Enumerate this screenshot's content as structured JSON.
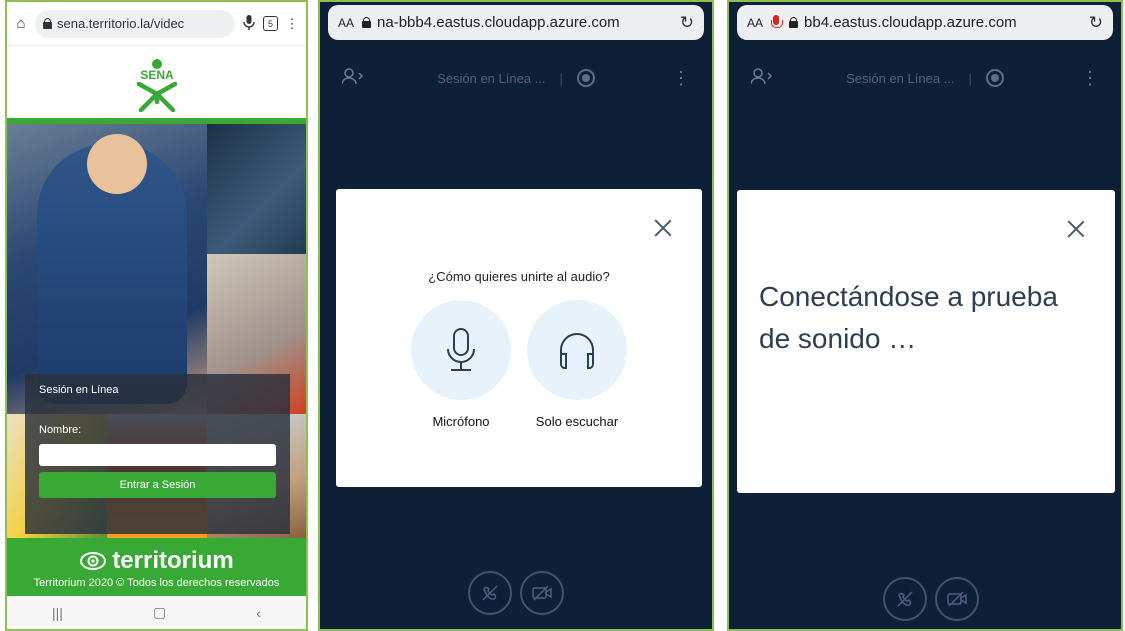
{
  "panel1": {
    "browser": {
      "url": "sena.territorio.la/videc",
      "tab_count": "5"
    },
    "logo_text": "SENA",
    "login": {
      "title": "Sesión en Línea",
      "name_label": "Nombre:",
      "name_value": "",
      "button": "Entrar a Sesión"
    },
    "footer": {
      "brand": "territorium",
      "copyright": "Territorium 2020 © Todos los derechos reservados"
    }
  },
  "panel2": {
    "browser": {
      "aa": "AA",
      "url": "na-bbb4.eastus.cloudapp.azure.com"
    },
    "session_title": "Sesión en Línea ...",
    "modal": {
      "question": "¿Cómo quieres unirte al audio?",
      "option_mic": "Micrófono",
      "option_listen": "Solo escuchar"
    }
  },
  "panel3": {
    "browser": {
      "aa": "AA",
      "url": "bb4.eastus.cloudapp.azure.com"
    },
    "session_title": "Sesión en Línea ...",
    "modal": {
      "message": "Conectándose a prueba de sonido …"
    }
  },
  "colors": {
    "sena_green": "#39a935",
    "dark_bg": "#0e2038",
    "modal_circle": "#e7f2fa"
  }
}
